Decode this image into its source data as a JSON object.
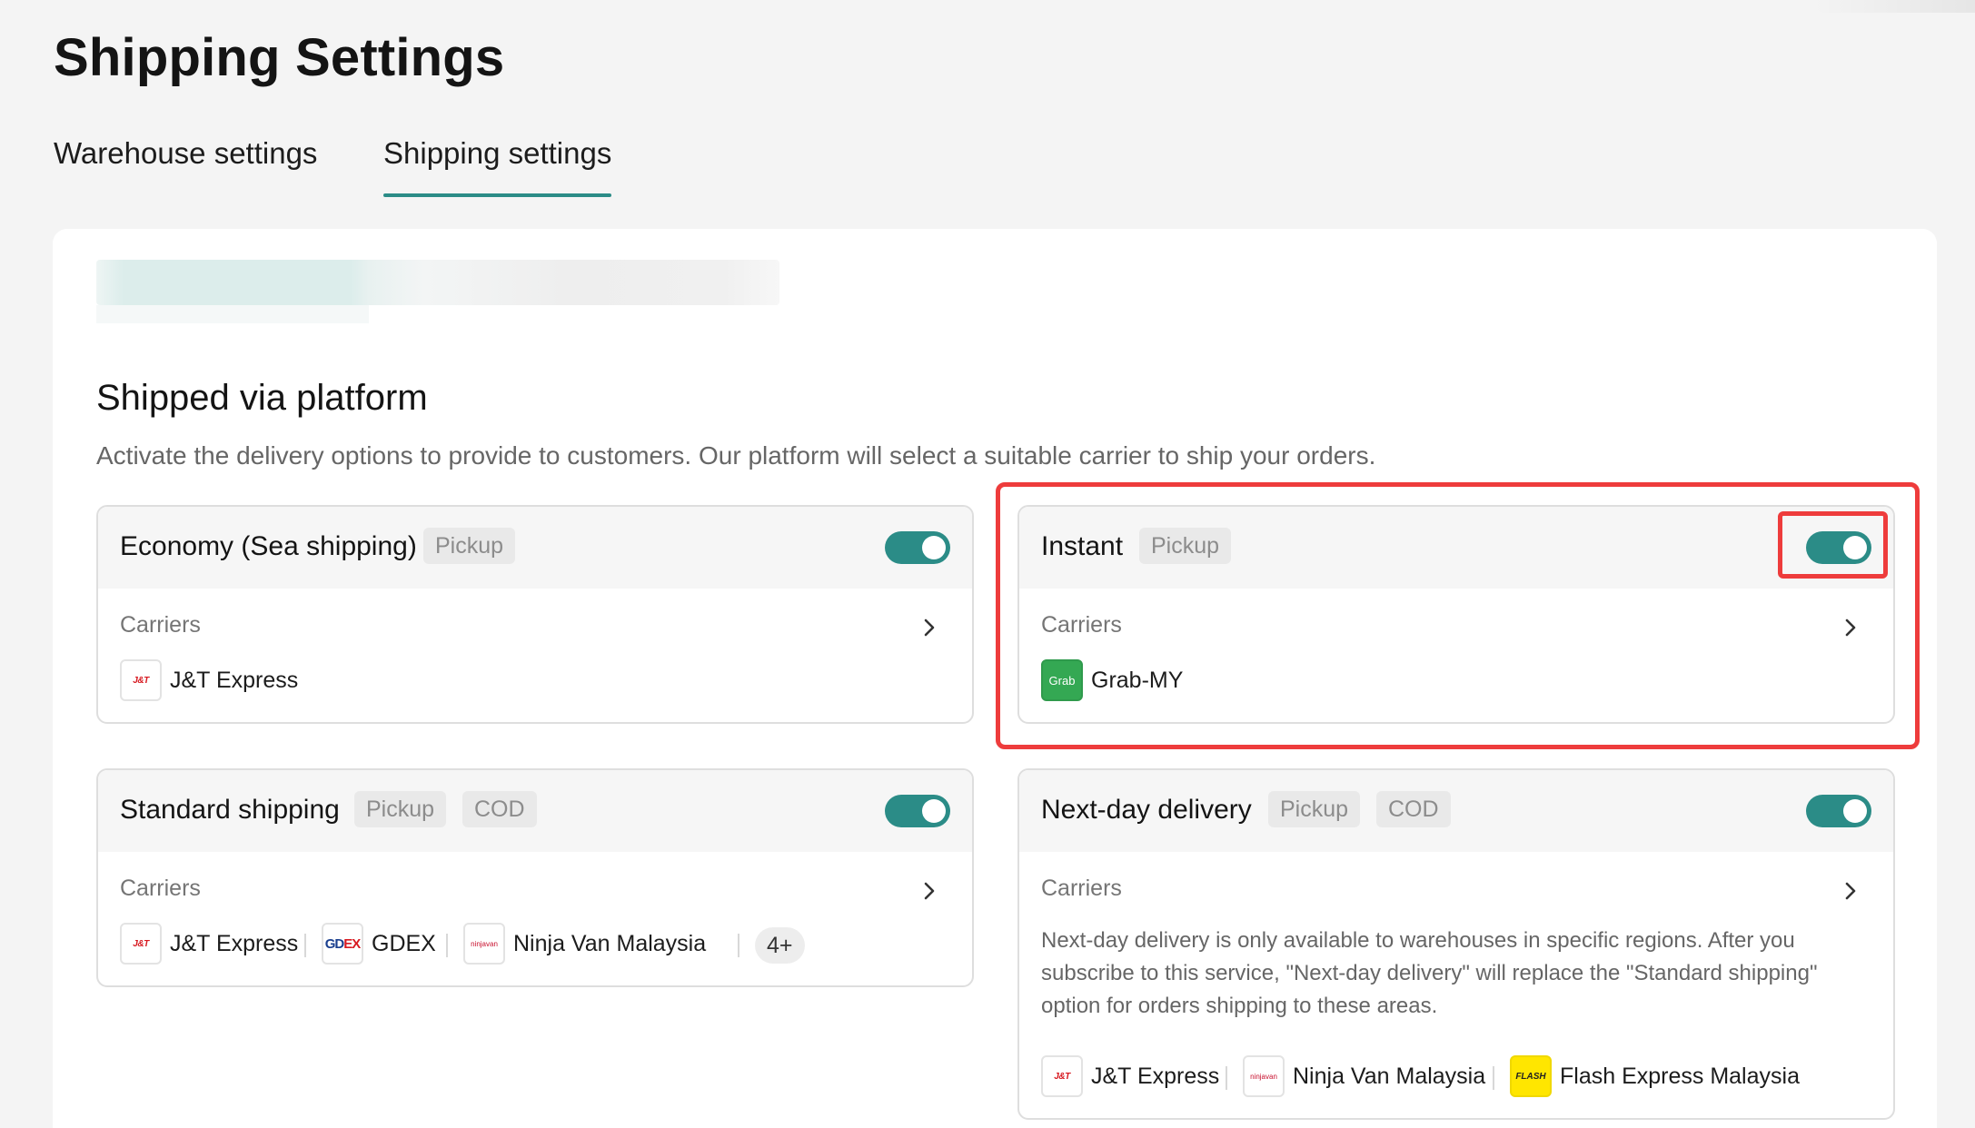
{
  "page": {
    "title": "Shipping Settings"
  },
  "tabs": [
    {
      "label": "Warehouse settings",
      "active": false
    },
    {
      "label": "Shipping settings",
      "active": true
    }
  ],
  "section": {
    "title": "Shipped via platform",
    "description": "Activate the delivery options to provide to customers. Our platform will select a suitable carrier to ship your orders."
  },
  "cards": {
    "economy": {
      "title": "Economy (Sea shipping)",
      "tags": [
        "Pickup"
      ],
      "enabled": true,
      "carriers_label": "Carriers",
      "carriers": [
        {
          "name": "J&T Express",
          "logo": "J&T"
        }
      ]
    },
    "instant": {
      "title": "Instant",
      "tags": [
        "Pickup"
      ],
      "enabled": true,
      "carriers_label": "Carriers",
      "carriers": [
        {
          "name": "Grab-MY",
          "logo": "Grab"
        }
      ]
    },
    "standard": {
      "title": "Standard shipping",
      "tags": [
        "Pickup",
        "COD"
      ],
      "enabled": true,
      "carriers_label": "Carriers",
      "carriers": [
        {
          "name": "J&T Express",
          "logo": "J&T"
        },
        {
          "name": "GDEX",
          "logo": "GD",
          "logo_accent": "EX"
        },
        {
          "name": "Ninja Van Malaysia",
          "logo": "ninjavan"
        }
      ],
      "more": "4+"
    },
    "nextday": {
      "title": "Next-day delivery",
      "tags": [
        "Pickup",
        "COD"
      ],
      "enabled": true,
      "carriers_label": "Carriers",
      "note": "Next-day delivery is only available to warehouses in specific regions. After you subscribe to this service, \"Next-day delivery\" will replace the \"Standard shipping\" option for orders shipping to these areas.",
      "carriers": [
        {
          "name": "J&T Express",
          "logo": "J&T"
        },
        {
          "name": "Ninja Van Malaysia",
          "logo": "ninjavan"
        },
        {
          "name": "Flash Express Malaysia",
          "logo": "FLASH"
        }
      ]
    }
  },
  "colors": {
    "accent": "#2b8c87",
    "highlight": "#ee3c3c",
    "background": "#f4f4f4"
  },
  "icons": {
    "chevron": "chevron-right-icon"
  }
}
